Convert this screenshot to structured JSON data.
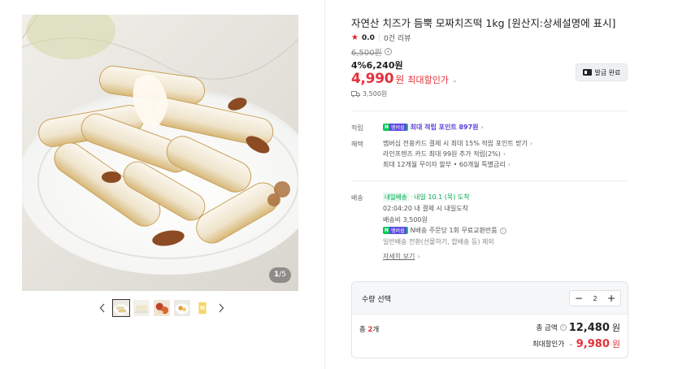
{
  "product": {
    "title": "자연산 치즈가 듬뿍 모짜치즈떡 1kg [원산지:상세설명에 표시]",
    "rating": "0.0",
    "reviews": "0건 리뷰",
    "original_price": "6,500원",
    "discount_line": "4%6,240원",
    "max_discount_price": "4,990",
    "won": "원",
    "max_discount_label": "최대할인가",
    "shipping_cost": "3,500원",
    "coupon_button": "발급 완료"
  },
  "gallery": {
    "counter_current": "1",
    "counter_total": "/5",
    "thumbnail_count_shown": 5
  },
  "benefits": {
    "point_label": "적립",
    "npay_badge": "N",
    "membership_badge": "멤버쉽",
    "point_text": "최대 적립 포인트 897원",
    "benefit_label": "혜택",
    "benefit_lines": [
      "멤버십 전용카드 결제 시 최대 15% 적립 포인트 받기",
      "라인프렌즈 카드 최대 99원 추가 적립(2%)",
      "최대 12개월 무이자 할부 • 60개월 특별금리"
    ]
  },
  "delivery": {
    "label": "배송",
    "arrival_badge": "내일배송",
    "arrival_text": "내일 10.1 (목) 도착",
    "time_text": "02:04:20  내 결제 시 내일도착",
    "shipping_fee": "배송비 3,500원",
    "exchange_text": "N배송 주문당 1회 무료교환반품",
    "exclusion_text": "일반배송 전환(선물하기, 합배송 등) 제외",
    "detail_link": "자세히 보기"
  },
  "purchase": {
    "quantity_label": "수량 선택",
    "minus": "−",
    "plus": "+",
    "quantity": "2",
    "total_prefix": "총 ",
    "total_count": "2",
    "total_suffix": "개",
    "total_amount_label": "총 금액",
    "total_amount": "12,480",
    "won": "원",
    "max_total_label": "최대할인가",
    "max_total": "9,980"
  },
  "colors": {
    "accent_red": "#e4323c",
    "npay_green": "#03c75a",
    "point_purple": "#5b3fd6"
  }
}
